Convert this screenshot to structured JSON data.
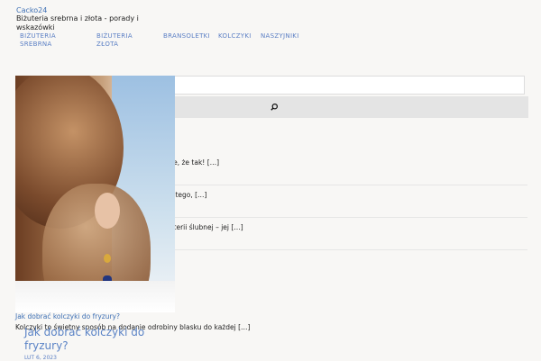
{
  "site": {
    "title": "Cacko24",
    "tagline": "Biżuteria srebrna i złota - porady i wskazówki"
  },
  "nav": {
    "items": [
      {
        "label": "BIŻUTERIA SREBRNA"
      },
      {
        "label": "BIŻUTERIA ZŁOTA"
      },
      {
        "label": "BRANSOLETKI"
      },
      {
        "label": "KOLCZYKI"
      },
      {
        "label": "NASZYJNIKI"
      }
    ]
  },
  "search": {
    "placeholder": "",
    "button_icon": "search-icon"
  },
  "sidebar_posts": [
    {
      "excerpt": "ście, że tak! […]"
    },
    {
      "excerpt": "dlatego, […]"
    },
    {
      "excerpt": "biżuterii ślubnej – jej […]"
    }
  ],
  "featured_post": {
    "link_text": "Jak dobrać kolczyki do fryzury?",
    "excerpt": "Kolczyki to świetny sposób na dodanie odrobiny blasku do każdej […]",
    "heading": "Jak dobrać kolczyki do fryzury?",
    "date": "LUT 6, 2023"
  }
}
